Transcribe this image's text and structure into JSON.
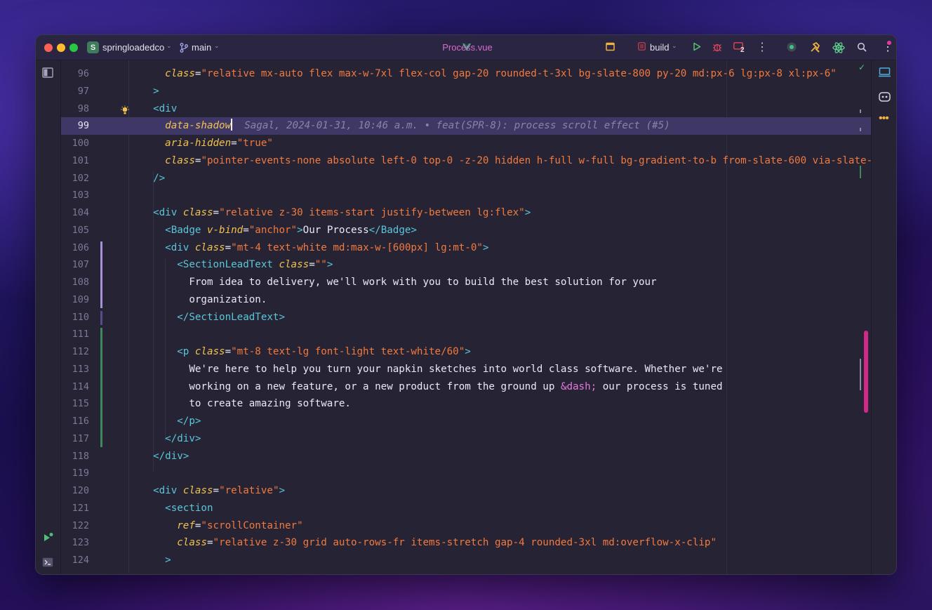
{
  "titlebar": {
    "project_initial": "S",
    "project_name": "springloadedco",
    "branch": "main",
    "file_name": "Process.vue",
    "run_config": "build",
    "notification_count": "2"
  },
  "colors": {
    "accent": "#d76bd2",
    "tag": "#5ac7d8",
    "attribute": "#f2c24e",
    "string": "#f27a3d",
    "current_line": "#3f3766",
    "scrollbar": "#d02a88"
  },
  "blame": "Sagal, 2024-01-31, 10:46 a.m. • feat(SPR-8): process scroll effect (#5)",
  "lines": [
    {
      "n": "96",
      "tokens": [
        {
          "t": "    "
        },
        {
          "t": "class",
          "c": "attr"
        },
        {
          "t": "=",
          "c": "text"
        },
        {
          "t": "\"relative mx-auto flex max-w-7xl flex-col gap-20 rounded-t-3xl bg-slate-800 py-20 md:px-6 lg:px-8 xl:px-6\"",
          "c": "str"
        }
      ]
    },
    {
      "n": "97",
      "tokens": [
        {
          "t": "  "
        },
        {
          "t": ">",
          "c": "tag"
        }
      ]
    },
    {
      "n": "98",
      "tokens": [
        {
          "t": "  "
        },
        {
          "t": "<div",
          "c": "tag"
        }
      ]
    },
    {
      "n": "99",
      "tokens": [
        {
          "t": "    "
        },
        {
          "t": "data-shadow",
          "c": "attr"
        }
      ]
    },
    {
      "n": "100",
      "tokens": [
        {
          "t": "    "
        },
        {
          "t": "aria-hidden",
          "c": "attr"
        },
        {
          "t": "=",
          "c": "text"
        },
        {
          "t": "\"true\"",
          "c": "str"
        }
      ]
    },
    {
      "n": "101",
      "tokens": [
        {
          "t": "    "
        },
        {
          "t": "class",
          "c": "attr"
        },
        {
          "t": "=",
          "c": "text"
        },
        {
          "t": "\"pointer-events-none absolute left-0 top-0 -z-20 hidden h-full w-full bg-gradient-to-b from-slate-600 via-slate-",
          "c": "str"
        }
      ]
    },
    {
      "n": "102",
      "tokens": [
        {
          "t": "  "
        },
        {
          "t": "/>",
          "c": "tag"
        }
      ]
    },
    {
      "n": "103",
      "tokens": []
    },
    {
      "n": "104",
      "tokens": [
        {
          "t": "  "
        },
        {
          "t": "<div ",
          "c": "tag"
        },
        {
          "t": "class",
          "c": "attr"
        },
        {
          "t": "=",
          "c": "text"
        },
        {
          "t": "\"relative z-30 items-start justify-between lg:flex\"",
          "c": "str"
        },
        {
          "t": ">",
          "c": "tag"
        }
      ]
    },
    {
      "n": "105",
      "tokens": [
        {
          "t": "    "
        },
        {
          "t": "<Badge ",
          "c": "tag"
        },
        {
          "t": "v-bind",
          "c": "attr"
        },
        {
          "t": "=",
          "c": "text"
        },
        {
          "t": "\"anchor\"",
          "c": "str"
        },
        {
          "t": ">",
          "c": "tag"
        },
        {
          "t": "Our Process",
          "c": "text"
        },
        {
          "t": "</Badge>",
          "c": "tag"
        }
      ]
    },
    {
      "n": "106",
      "tokens": [
        {
          "t": "    "
        },
        {
          "t": "<div ",
          "c": "tag"
        },
        {
          "t": "class",
          "c": "attr"
        },
        {
          "t": "=",
          "c": "text"
        },
        {
          "t": "\"mt-4 text-white md:max-w-[600px] lg:mt-0\"",
          "c": "str"
        },
        {
          "t": ">",
          "c": "tag"
        }
      ]
    },
    {
      "n": "107",
      "tokens": [
        {
          "t": "      "
        },
        {
          "t": "<SectionLeadText ",
          "c": "tag"
        },
        {
          "t": "class",
          "c": "attr"
        },
        {
          "t": "=",
          "c": "text"
        },
        {
          "t": "\"\"",
          "c": "str"
        },
        {
          "t": ">",
          "c": "tag"
        }
      ]
    },
    {
      "n": "108",
      "tokens": [
        {
          "t": "        "
        },
        {
          "t": "From idea to delivery, we'll work with you to build the best solution for your",
          "c": "text"
        }
      ]
    },
    {
      "n": "109",
      "tokens": [
        {
          "t": "        "
        },
        {
          "t": "organization.",
          "c": "text"
        }
      ]
    },
    {
      "n": "110",
      "tokens": [
        {
          "t": "      "
        },
        {
          "t": "</SectionLeadText>",
          "c": "tag"
        }
      ]
    },
    {
      "n": "111",
      "tokens": []
    },
    {
      "n": "112",
      "tokens": [
        {
          "t": "      "
        },
        {
          "t": "<p ",
          "c": "tag"
        },
        {
          "t": "class",
          "c": "attr"
        },
        {
          "t": "=",
          "c": "text"
        },
        {
          "t": "\"mt-8 text-lg font-light text-white/60\"",
          "c": "str"
        },
        {
          "t": ">",
          "c": "tag"
        }
      ]
    },
    {
      "n": "113",
      "tokens": [
        {
          "t": "        "
        },
        {
          "t": "We're here to help you turn your napkin sketches into world class software. Whether we're",
          "c": "text"
        }
      ]
    },
    {
      "n": "114",
      "tokens": [
        {
          "t": "        "
        },
        {
          "t": "working on a new feature, or a new product from the ground up ",
          "c": "text"
        },
        {
          "t": "&dash;",
          "c": "ent"
        },
        {
          "t": " our process is tuned",
          "c": "text"
        }
      ]
    },
    {
      "n": "115",
      "tokens": [
        {
          "t": "        "
        },
        {
          "t": "to create amazing software.",
          "c": "text"
        }
      ]
    },
    {
      "n": "116",
      "tokens": [
        {
          "t": "      "
        },
        {
          "t": "</p>",
          "c": "tag"
        }
      ]
    },
    {
      "n": "117",
      "tokens": [
        {
          "t": "    "
        },
        {
          "t": "</div>",
          "c": "tag"
        }
      ]
    },
    {
      "n": "118",
      "tokens": [
        {
          "t": "  "
        },
        {
          "t": "</div>",
          "c": "tag"
        }
      ]
    },
    {
      "n": "119",
      "tokens": []
    },
    {
      "n": "120",
      "tokens": [
        {
          "t": "  "
        },
        {
          "t": "<div ",
          "c": "tag"
        },
        {
          "t": "class",
          "c": "attr"
        },
        {
          "t": "=",
          "c": "text"
        },
        {
          "t": "\"relative\"",
          "c": "str"
        },
        {
          "t": ">",
          "c": "tag"
        }
      ]
    },
    {
      "n": "121",
      "tokens": [
        {
          "t": "    "
        },
        {
          "t": "<section",
          "c": "tag"
        }
      ]
    },
    {
      "n": "122",
      "tokens": [
        {
          "t": "      "
        },
        {
          "t": "ref",
          "c": "attr"
        },
        {
          "t": "=",
          "c": "text"
        },
        {
          "t": "\"scrollContainer\"",
          "c": "str"
        }
      ]
    },
    {
      "n": "123",
      "tokens": [
        {
          "t": "      "
        },
        {
          "t": "class",
          "c": "attr"
        },
        {
          "t": "=",
          "c": "text"
        },
        {
          "t": "\"relative z-30 grid auto-rows-fr items-stretch gap-4 rounded-3xl md:overflow-x-clip\"",
          "c": "str"
        }
      ]
    },
    {
      "n": "124",
      "tokens": [
        {
          "t": "    "
        },
        {
          "t": ">",
          "c": "tag"
        }
      ]
    }
  ]
}
